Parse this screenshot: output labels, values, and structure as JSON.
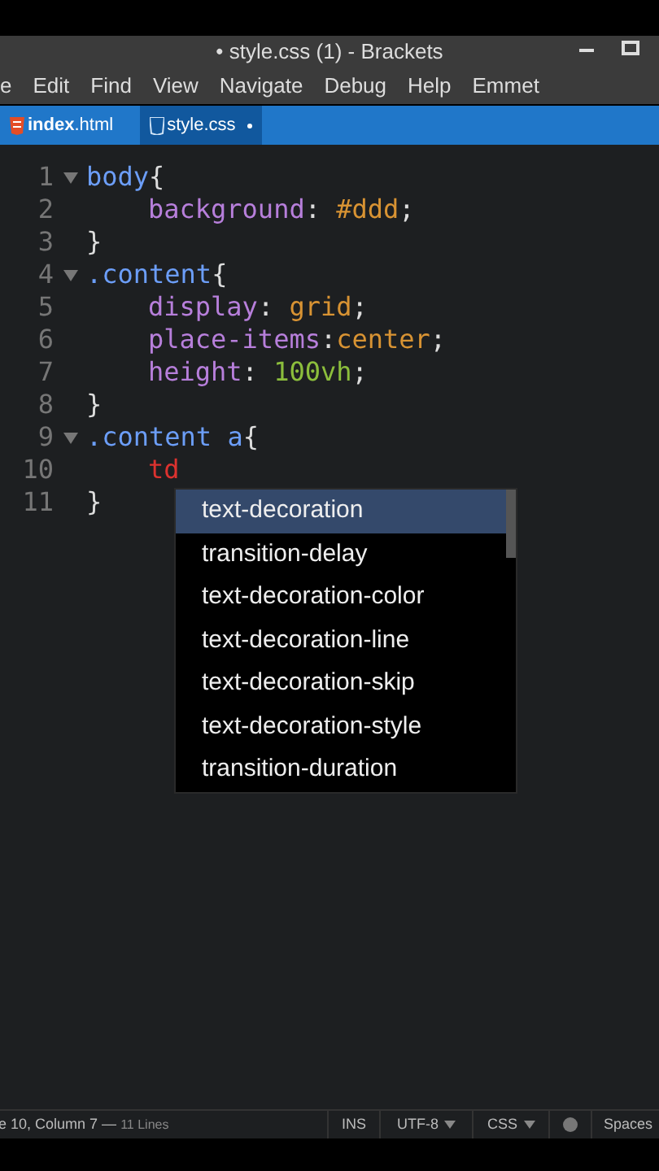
{
  "window": {
    "title": "• style.css (1) - Brackets"
  },
  "menu": [
    "e",
    "Edit",
    "Find",
    "View",
    "Navigate",
    "Debug",
    "Help",
    "Emmet"
  ],
  "tabs": [
    {
      "label": "**index**.html",
      "kind": "html",
      "selected": false,
      "modified": false
    },
    {
      "label": "style.css",
      "kind": "css",
      "selected": true,
      "modified": true
    }
  ],
  "code": [
    {
      "number": "1",
      "fold": true,
      "indented": false,
      "tokens": [
        {
          "text": "body",
          "kind": "selector"
        },
        {
          "text": "{",
          "kind": "punct"
        }
      ]
    },
    {
      "number": "2",
      "fold": false,
      "indented": true,
      "tokens": [
        {
          "text": "background",
          "kind": "property"
        },
        {
          "text": ": ",
          "kind": "punct"
        },
        {
          "text": "#ddd",
          "kind": "value"
        },
        {
          "text": ";",
          "kind": "punct"
        }
      ]
    },
    {
      "number": "3",
      "fold": false,
      "indented": false,
      "tokens": [
        {
          "text": "}",
          "kind": "punct"
        }
      ]
    },
    {
      "number": "4",
      "fold": true,
      "indented": false,
      "tokens": [
        {
          "text": ".content",
          "kind": "selector"
        },
        {
          "text": "{",
          "kind": "punct"
        }
      ]
    },
    {
      "number": "5",
      "fold": false,
      "indented": true,
      "tokens": [
        {
          "text": "display",
          "kind": "property"
        },
        {
          "text": ": ",
          "kind": "punct"
        },
        {
          "text": "grid",
          "kind": "value"
        },
        {
          "text": ";",
          "kind": "punct"
        }
      ]
    },
    {
      "number": "6",
      "fold": false,
      "indented": true,
      "tokens": [
        {
          "text": "place-items",
          "kind": "property"
        },
        {
          "text": ":",
          "kind": "punct"
        },
        {
          "text": "center",
          "kind": "value"
        },
        {
          "text": ";",
          "kind": "punct"
        }
      ]
    },
    {
      "number": "7",
      "fold": false,
      "indented": true,
      "tokens": [
        {
          "text": "height",
          "kind": "property"
        },
        {
          "text": ": ",
          "kind": "punct"
        },
        {
          "text": "100vh",
          "kind": "number"
        },
        {
          "text": ";",
          "kind": "punct"
        }
      ]
    },
    {
      "number": "8",
      "fold": false,
      "indented": false,
      "tokens": [
        {
          "text": "}",
          "kind": "punct"
        }
      ]
    },
    {
      "number": "9",
      "fold": true,
      "indented": false,
      "tokens": [
        {
          "text": ".content a",
          "kind": "selector"
        },
        {
          "text": "{",
          "kind": "punct"
        }
      ]
    },
    {
      "number": "10",
      "fold": false,
      "indented": true,
      "tokens": [
        {
          "text": "td",
          "kind": "error"
        }
      ]
    },
    {
      "number": "11",
      "fold": false,
      "indented": false,
      "tokens": [
        {
          "text": "}",
          "kind": "punct"
        }
      ]
    }
  ],
  "hints": [
    {
      "label": "text-decoration",
      "selected": true
    },
    {
      "label": "transition-delay",
      "selected": false
    },
    {
      "label": "text-decoration-color",
      "selected": false
    },
    {
      "label": "text-decoration-line",
      "selected": false
    },
    {
      "label": "text-decoration-skip",
      "selected": false
    },
    {
      "label": "text-decoration-style",
      "selected": false
    },
    {
      "label": "transition-duration",
      "selected": false
    }
  ],
  "status_bar": {
    "position": "e 10, Column 7 —",
    "lines": "11 Lines",
    "mode": "INS",
    "encoding": "UTF-8",
    "language": "CSS",
    "indent": "Spaces"
  }
}
